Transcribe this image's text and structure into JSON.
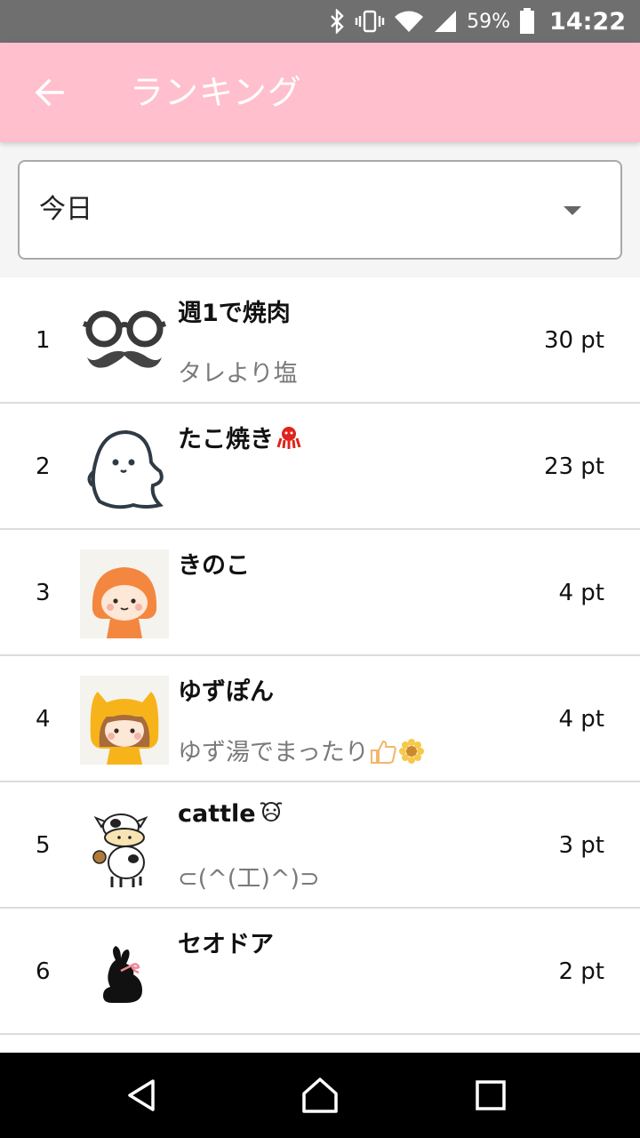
{
  "status_bar": {
    "battery_percent": "59%",
    "time": "14:22",
    "icons": [
      "bluetooth-icon",
      "vibrate-icon",
      "wifi-icon",
      "cell-signal-icon",
      "battery-icon"
    ]
  },
  "app_bar": {
    "title": "ランキング",
    "back_icon": "arrow-left-icon",
    "background": "#ffbfcc"
  },
  "filter": {
    "selected": "今日"
  },
  "ranking": [
    {
      "rank": "1",
      "name": "週1で焼肉",
      "status": "タレより塩",
      "points": "30 pt",
      "avatar": "glasses-mustache"
    },
    {
      "rank": "2",
      "name": "たこ焼き",
      "status": "",
      "points": "23 pt",
      "avatar": "ghost",
      "name_emoji": "octopus"
    },
    {
      "rank": "3",
      "name": "きのこ",
      "status": "",
      "points": "4 pt",
      "avatar": "mushroom-hood-girl"
    },
    {
      "rank": "4",
      "name": "ゆずぽん",
      "status": "ゆず湯でまったり",
      "points": "4 pt",
      "avatar": "cat-hood-girl",
      "status_emoji": [
        "thumbs-up",
        "sunflower"
      ]
    },
    {
      "rank": "5",
      "name": "cattle",
      "status": "⊂(^(工)^)⊃",
      "points": "3 pt",
      "avatar": "cow",
      "name_emoji": "cow-face"
    },
    {
      "rank": "6",
      "name": "セオドア",
      "status": "",
      "points": "2 pt",
      "avatar": "black-rabbit"
    }
  ],
  "nav": {
    "icons": [
      "back-triangle-icon",
      "home-icon",
      "recents-square-icon"
    ]
  }
}
